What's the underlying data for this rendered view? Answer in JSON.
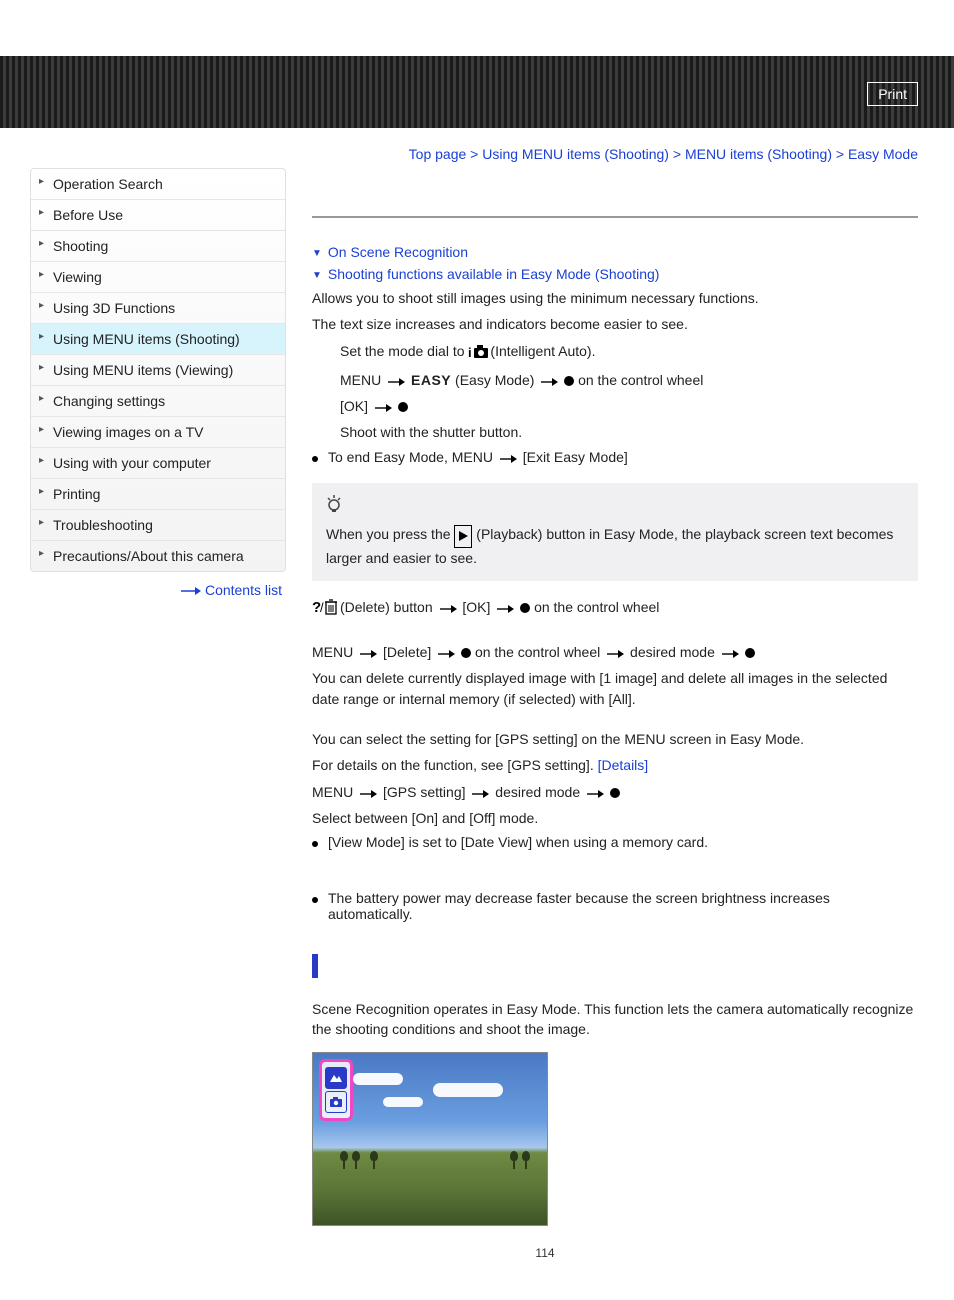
{
  "header": {
    "print": "Print"
  },
  "breadcrumb": {
    "top": "Top page",
    "l1": "Using MENU items (Shooting)",
    "l2": "MENU items (Shooting)",
    "l3": "Easy Mode",
    "sep": " > "
  },
  "sidebar": {
    "items": [
      "Operation Search",
      "Before Use",
      "Shooting",
      "Viewing",
      "Using 3D Functions",
      "Using MENU items (Shooting)",
      "Using MENU items (Viewing)",
      "Changing settings",
      "Viewing images on a TV",
      "Using with your computer",
      "Printing",
      "Troubleshooting",
      "Precautions/About this camera"
    ],
    "active_index": 5,
    "contents": "Contents list"
  },
  "anchors": {
    "a1": "On Scene Recognition",
    "a2": "Shooting functions available in Easy Mode (Shooting)"
  },
  "intro": {
    "p1": "Allows you to shoot still images using the minimum necessary functions.",
    "p2": "The text size increases and indicators become easier to see."
  },
  "steps": {
    "s1a": "Set the mode dial to ",
    "s1b": "(Intelligent Auto).",
    "s2a": "MENU ",
    "s2easy": "EASY",
    "s2b": "(Easy Mode) ",
    "s2c": " on the control wheel",
    "s3a": "[OK] ",
    "s4": "Shoot with the shutter button.",
    "s4b1": "To end Easy Mode, MENU ",
    "s4b2": " [Exit Easy Mode]"
  },
  "tip": {
    "t1a": "When you press the ",
    "t1b": "(Playback) button in Easy Mode, the playback screen text becomes larger and easier to see."
  },
  "del1": {
    "a": "(Delete) button ",
    "b": " [OK] ",
    "c": " on the control wheel"
  },
  "del2": {
    "a": "MENU ",
    "b": " [Delete] ",
    "c": " on the control wheel ",
    "d": " desired mode "
  },
  "del3": "You can delete currently displayed image with [1 image] and delete all images in the selected date range or internal memory (if selected) with [All].",
  "gps": {
    "p1": "You can select the setting for [GPS setting] on the MENU screen in Easy Mode.",
    "p2a": "For details on the function, see [GPS setting]. ",
    "p2b": "[Details]",
    "p3a": "MENU ",
    "p3b": " [GPS setting] ",
    "p3c": " desired mode ",
    "p4": "Select between [On] and [Off] mode.",
    "b1": "[View Mode] is set to [Date View] when using a memory card."
  },
  "note": {
    "b1": "The battery power may decrease faster because the screen brightness increases automatically."
  },
  "scene": {
    "p1": "Scene Recognition operates in Easy Mode. This function lets the camera automatically recognize the shooting conditions and shoot the image."
  },
  "page": "114"
}
